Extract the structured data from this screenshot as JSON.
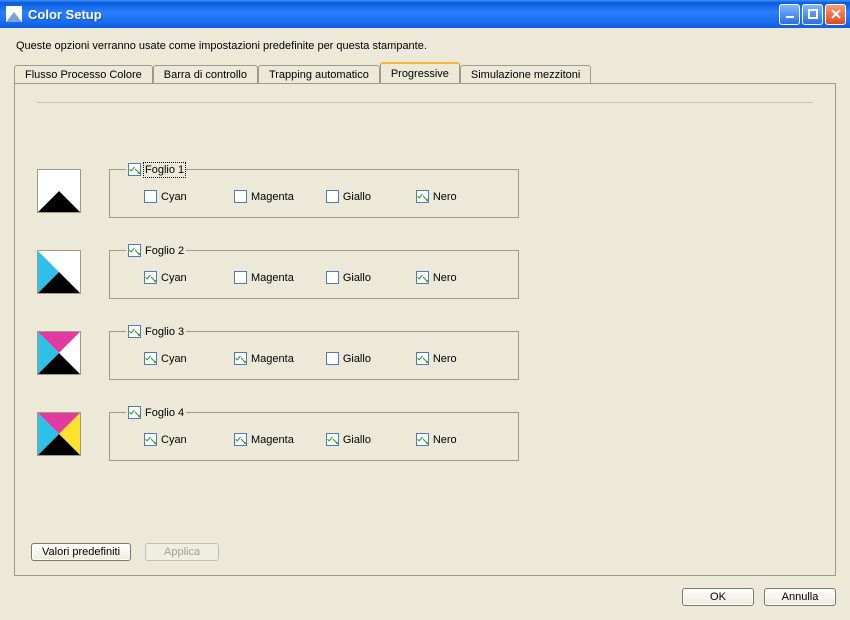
{
  "window": {
    "title": "Color Setup"
  },
  "description": "Queste opzioni verranno usate come impostazioni predefinite per questa stampante.",
  "tabs": [
    {
      "label": "Flusso Processo Colore"
    },
    {
      "label": "Barra di controllo"
    },
    {
      "label": "Trapping automatico"
    },
    {
      "label": "Progressive",
      "active": true
    },
    {
      "label": "Simulazione mezzitoni"
    }
  ],
  "ink_labels": {
    "cyan": "Cyan",
    "magenta": "Magenta",
    "yellow": "Giallo",
    "black": "Nero"
  },
  "sheets": [
    {
      "legend": "Foglio 1",
      "legend_checked": true,
      "focused": true,
      "cyan": false,
      "magenta": false,
      "yellow": false,
      "black": true
    },
    {
      "legend": "Foglio 2",
      "legend_checked": true,
      "focused": false,
      "cyan": true,
      "magenta": false,
      "yellow": false,
      "black": true
    },
    {
      "legend": "Foglio 3",
      "legend_checked": true,
      "focused": false,
      "cyan": true,
      "magenta": true,
      "yellow": false,
      "black": true
    },
    {
      "legend": "Foglio 4",
      "legend_checked": true,
      "focused": false,
      "cyan": true,
      "magenta": true,
      "yellow": true,
      "black": true
    }
  ],
  "panel_buttons": {
    "defaults": "Valori predefiniti",
    "apply": "Applica",
    "apply_enabled": false
  },
  "dialog_buttons": {
    "ok": "OK",
    "cancel": "Annulla"
  },
  "colors": {
    "cyan": "#2fc0e8",
    "magenta": "#e23aa0",
    "yellow": "#ffe22e",
    "black": "#000000"
  }
}
